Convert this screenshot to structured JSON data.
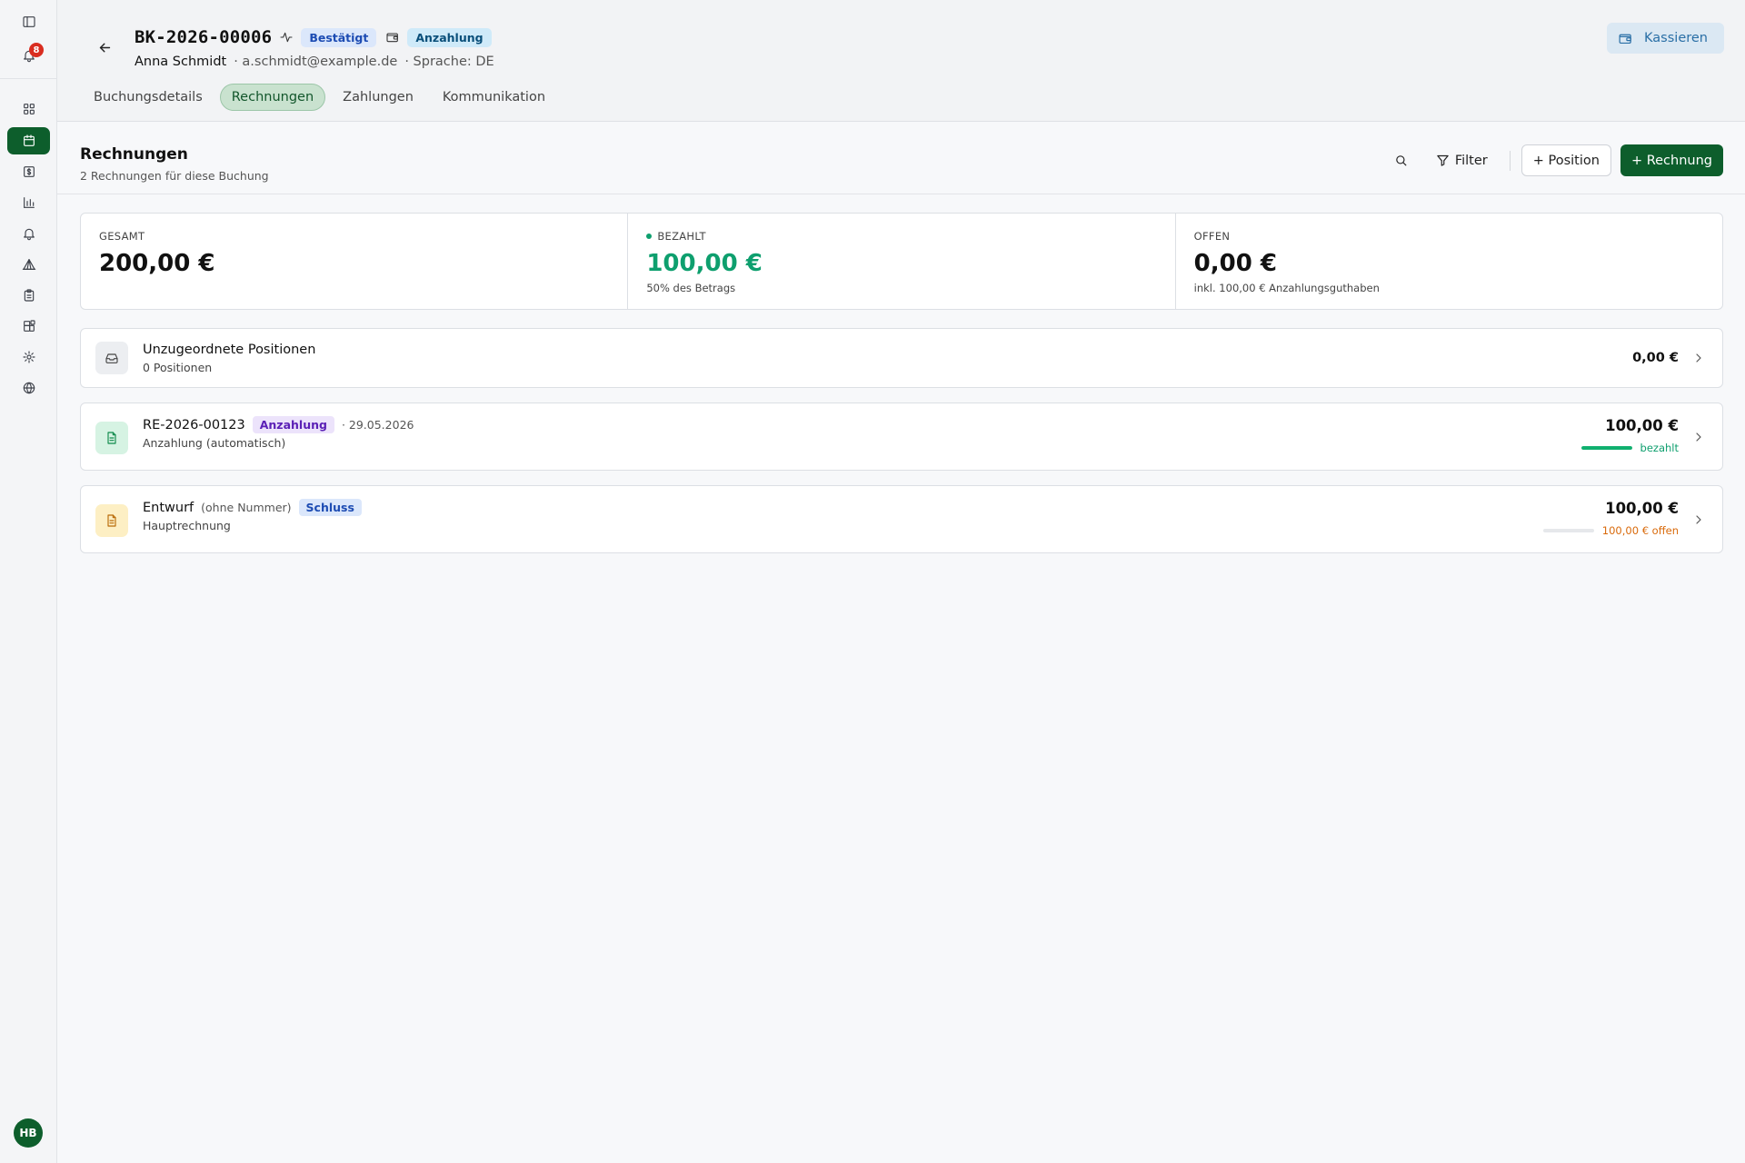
{
  "sidebar": {
    "notification_count": "8",
    "items": [
      {
        "name": "dashboard-icon"
      },
      {
        "name": "calendar-icon",
        "active": true
      },
      {
        "name": "dollar-icon"
      },
      {
        "name": "bar-chart-icon"
      },
      {
        "name": "bell-icon"
      },
      {
        "name": "tent-icon"
      },
      {
        "name": "clipboard-icon"
      },
      {
        "name": "blocks-icon"
      },
      {
        "name": "gear-icon"
      },
      {
        "name": "globe-icon"
      }
    ],
    "user_initials": "HB"
  },
  "header": {
    "booking_id": "BK-2026-00006",
    "status_label": "Bestätigt",
    "payment_label": "Anzahlung",
    "customer_name": "Anna Schmidt",
    "customer_email": "· a.schmidt@example.de",
    "language": "· Sprache: DE",
    "cash_button": "Kassieren",
    "tabs": [
      {
        "label": "Buchungsdetails",
        "active": false
      },
      {
        "label": "Rechnungen",
        "active": true
      },
      {
        "label": "Zahlungen",
        "active": false
      },
      {
        "label": "Kommunikation",
        "active": false
      }
    ]
  },
  "section": {
    "title": "Rechnungen",
    "subtitle": "2 Rechnungen für diese Buchung",
    "filter_label": "Filter",
    "add_position_label": "+ Position",
    "add_invoice_label": "+ Rechnung"
  },
  "summary": {
    "total": {
      "label": "GESAMT",
      "value": "200,00 €"
    },
    "paid": {
      "label": "BEZAHLT",
      "value": "100,00 €",
      "note": "50% des Betrags",
      "color": "#0e9f6e"
    },
    "open": {
      "label": "OFFEN",
      "value": "0,00 €",
      "note": "inkl. 100,00 € Anzahlungsguthaben"
    }
  },
  "rows": {
    "unassigned": {
      "title": "Unzugeordnete Positionen",
      "subtitle": "0 Positionen",
      "amount": "0,00 €"
    },
    "invoice1": {
      "number": "RE-2026-00123",
      "tag": "Anzahlung",
      "date": "· 29.05.2026",
      "subtitle": "Anzahlung (automatisch)",
      "amount": "100,00 €",
      "status": "bezahlt",
      "paid_fraction": 1.0
    },
    "invoice2": {
      "title": "Entwurf",
      "number_note": "(ohne Nummer)",
      "tag": "Schluss",
      "subtitle": "Hauptrechnung",
      "amount": "100,00 €",
      "status": "100,00 € offen",
      "paid_fraction": 0.0
    }
  }
}
